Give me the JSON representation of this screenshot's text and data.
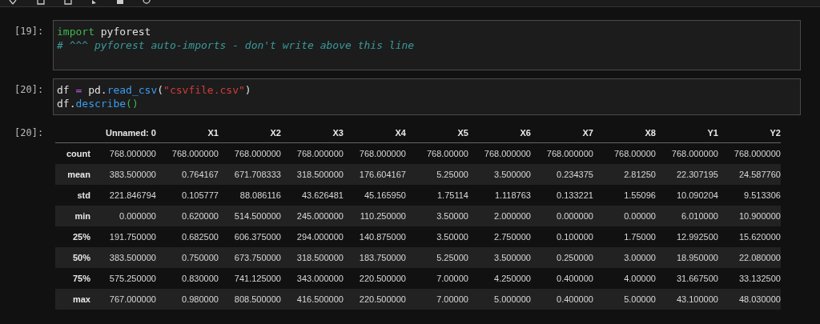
{
  "cells": [
    {
      "prompt": "[19]:",
      "lines": [
        [
          {
            "kind": "keyword",
            "text": "import"
          },
          {
            "kind": "plain",
            "text": " pyforest"
          }
        ],
        [
          {
            "kind": "comment",
            "text": "# ^^^ pyforest auto-imports - don't write above this line"
          }
        ]
      ]
    },
    {
      "prompt": "[20]:",
      "lines": [
        [
          {
            "kind": "plain",
            "text": "df "
          },
          {
            "kind": "operator",
            "text": "="
          },
          {
            "kind": "plain",
            "text": " pd."
          },
          {
            "kind": "function",
            "text": "read_csv"
          },
          {
            "kind": "plain",
            "text": "("
          },
          {
            "kind": "string",
            "text": "\"csvfile.csv\""
          },
          {
            "kind": "plain",
            "text": ")"
          }
        ],
        [
          {
            "kind": "plain",
            "text": "df."
          },
          {
            "kind": "function",
            "text": "describe"
          },
          {
            "kind": "paren",
            "text": "()"
          }
        ]
      ]
    }
  ],
  "output": {
    "prompt": "[20]:",
    "table": {
      "columns": [
        "Unnamed: 0",
        "X1",
        "X2",
        "X3",
        "X4",
        "X5",
        "X6",
        "X7",
        "X8",
        "Y1",
        "Y2"
      ],
      "rows": [
        {
          "label": "count",
          "cells": [
            "768.000000",
            "768.000000",
            "768.000000",
            "768.000000",
            "768.000000",
            "768.00000",
            "768.000000",
            "768.000000",
            "768.00000",
            "768.000000",
            "768.000000"
          ]
        },
        {
          "label": "mean",
          "cells": [
            "383.500000",
            "0.764167",
            "671.708333",
            "318.500000",
            "176.604167",
            "5.25000",
            "3.500000",
            "0.234375",
            "2.81250",
            "22.307195",
            "24.587760"
          ]
        },
        {
          "label": "std",
          "cells": [
            "221.846794",
            "0.105777",
            "88.086116",
            "43.626481",
            "45.165950",
            "1.75114",
            "1.118763",
            "0.133221",
            "1.55096",
            "10.090204",
            "9.513306"
          ]
        },
        {
          "label": "min",
          "cells": [
            "0.000000",
            "0.620000",
            "514.500000",
            "245.000000",
            "110.250000",
            "3.50000",
            "2.000000",
            "0.000000",
            "0.00000",
            "6.010000",
            "10.900000"
          ]
        },
        {
          "label": "25%",
          "cells": [
            "191.750000",
            "0.682500",
            "606.375000",
            "294.000000",
            "140.875000",
            "3.50000",
            "2.750000",
            "0.100000",
            "1.75000",
            "12.992500",
            "15.620000"
          ]
        },
        {
          "label": "50%",
          "cells": [
            "383.500000",
            "0.750000",
            "673.750000",
            "318.500000",
            "183.750000",
            "5.25000",
            "3.500000",
            "0.250000",
            "3.00000",
            "18.950000",
            "22.080000"
          ]
        },
        {
          "label": "75%",
          "cells": [
            "575.250000",
            "0.830000",
            "741.125000",
            "343.000000",
            "220.500000",
            "7.00000",
            "4.250000",
            "0.400000",
            "4.00000",
            "31.667500",
            "33.132500"
          ]
        },
        {
          "label": "max",
          "cells": [
            "767.000000",
            "0.980000",
            "808.500000",
            "416.500000",
            "220.500000",
            "7.00000",
            "5.000000",
            "0.400000",
            "5.00000",
            "43.100000",
            "48.030000"
          ]
        }
      ]
    }
  }
}
